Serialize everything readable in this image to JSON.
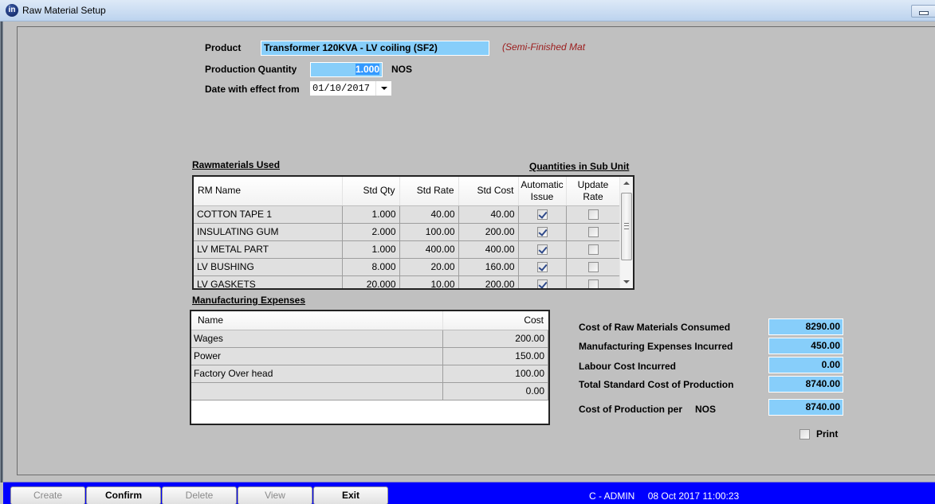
{
  "window": {
    "title": "Raw Material Setup",
    "app_icon": "in-logo-icon",
    "minimize_icon": "minimize-icon"
  },
  "header": {
    "product_label": "Product",
    "product_value": "Transformer 120KVA - LV coiling (SF2)",
    "product_type": "(Semi-Finished Mat",
    "quantity_label": "Production Quantity",
    "quantity_value": "1.000",
    "quantity_unit": "NOS",
    "date_label": "Date with effect from",
    "date_value": "01/10/2017"
  },
  "raw_materials": {
    "title": "Rawmaterials Used",
    "sub_unit_link": "Quantities in Sub Unit",
    "columns": {
      "name": "RM Name",
      "qty": "Std Qty",
      "rate": "Std Rate",
      "cost": "Std Cost",
      "auto_issue_1": "Automatic",
      "auto_issue_2": "Issue",
      "update_rate_1": "Update",
      "update_rate_2": "Rate"
    },
    "rows": [
      {
        "name": "COTTON TAPE 1",
        "qty": "1.000",
        "rate": "40.00",
        "cost": "40.00",
        "auto_issue": true,
        "update_rate": false
      },
      {
        "name": "INSULATING GUM",
        "qty": "2.000",
        "rate": "100.00",
        "cost": "200.00",
        "auto_issue": true,
        "update_rate": false
      },
      {
        "name": "LV METAL PART",
        "qty": "1.000",
        "rate": "400.00",
        "cost": "400.00",
        "auto_issue": true,
        "update_rate": false
      },
      {
        "name": "LV BUSHING",
        "qty": "8.000",
        "rate": "20.00",
        "cost": "160.00",
        "auto_issue": true,
        "update_rate": false
      },
      {
        "name": "LV GASKETS",
        "qty": "20.000",
        "rate": "10.00",
        "cost": "200.00",
        "auto_issue": true,
        "update_rate": false
      }
    ]
  },
  "expenses": {
    "title": "Manufacturing Expenses",
    "columns": {
      "name": "Name",
      "cost": "Cost"
    },
    "rows": [
      {
        "name": "Wages",
        "cost": "200.00"
      },
      {
        "name": "Power",
        "cost": "150.00"
      },
      {
        "name": "Factory Over head",
        "cost": "100.00"
      },
      {
        "name": "",
        "cost": "0.00"
      }
    ]
  },
  "summary": {
    "raw_materials_label": "Cost of Raw Materials Consumed",
    "raw_materials_value": "8290.00",
    "mfg_expenses_label": "Manufacturing Expenses Incurred",
    "mfg_expenses_value": "450.00",
    "labour_label": "Labour Cost Incurred",
    "labour_value": "0.00",
    "total_label": "Total Standard Cost of Production",
    "total_value": "8740.00",
    "per_unit_label": "Cost of Production per",
    "per_unit_unit": "NOS",
    "per_unit_value": "8740.00",
    "print_label": "Print",
    "print_checked": false
  },
  "toolbar": {
    "create_label": "Create",
    "confirm_label": "Confirm",
    "delete_label": "Delete",
    "view_label": "View",
    "exit_label": "Exit"
  },
  "status": {
    "user": "C - ADMIN",
    "datetime": "08 Oct 2017 11:00:23"
  },
  "colors": {
    "field_bg": "#87cefa",
    "bottom_bar": "#0000ff",
    "product_type_text": "#9b1b1b",
    "window_bg": "#c0c0c0"
  }
}
